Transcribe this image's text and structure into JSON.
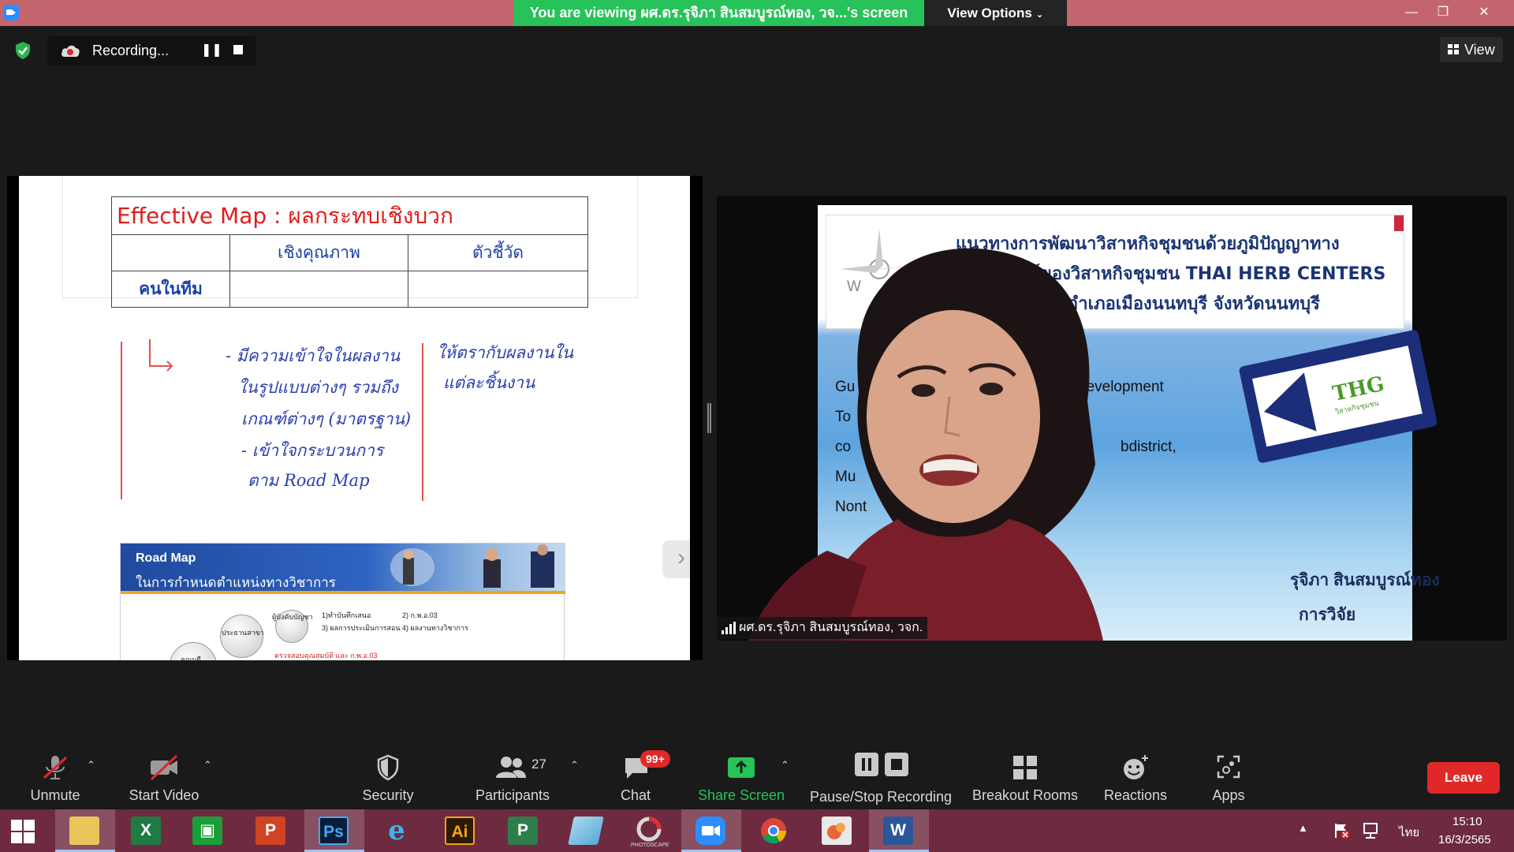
{
  "titlebar": {
    "banner": "You are viewing ผศ.ดร.รุจิภา สินสมบูรณ์ทอง, วจ...'s screen",
    "view_options": "View Options",
    "minimize": "—",
    "maximize": "❐",
    "close": "✕"
  },
  "recording": {
    "label": "Recording...",
    "pause": "❚❚"
  },
  "view_button": "View",
  "shared_screen": {
    "title": "Effective Map : ผลกระทบเชิงบวก",
    "col1": "เชิงคุณภาพ",
    "col2": "ตัวชี้วัด",
    "row1": "คนในทีม",
    "handwriting_left": [
      "- มีความเข้าใจในผลงาน",
      "ในรูปแบบต่างๆ รวมถึง",
      "เกณฑ์ต่างๆ (มาตรฐาน)",
      "- เข้าใจกระบวนการ",
      "ตาม Road Map"
    ],
    "handwriting_right": [
      "ให้ตรากับผลงานใน",
      "แต่ละชิ้นงาน"
    ],
    "roadmap_title": "Road Map",
    "roadmap_subtitle": "ในการกำหนดตำแหน่งทางวิชาการ",
    "roadmap_notes": [
      "1)ทำบันทึกเสนอ",
      "2) ก.พ.อ.03",
      "3) ผลการประเมินการสอน",
      "4) ผลงานทางวิชาการ",
      "ผู้บังคับบัญชา",
      "ประธานสาขา",
      "คณบดี",
      "ตรวจสอบคุณสมบัติ และ ก.พ.อ.03"
    ],
    "next": "›"
  },
  "video": {
    "slide_lines": [
      "แนวทางการพัฒนาวิสาหกิจชุมชนด้วยภูมิปัญญาทาง",
      "ย์ของวิสาหกิจชุมชน THAI HERB CENTERS",
      "อำเภอเมืองนนทบุรี จังหวัดนนทบุรี"
    ],
    "slide_left": [
      "Gu",
      "To",
      "co",
      "Mu",
      "Nont"
    ],
    "slide_right": [
      "development",
      "bdistrict,"
    ],
    "sign_logo": "THG",
    "sign_logo_sub": "วิสาหกิจชุมชน",
    "compass_w": "W",
    "presenter_slide_name": "รุจิภา สินสมบูรณ์ทอง",
    "presenter_slide_role": "การวิจัย",
    "name_tag": "ผศ.ดร.รุจิภา สินสมบูรณ์ทอง, วจก."
  },
  "toolbar": {
    "unmute": "Unmute",
    "start_video": "Start Video",
    "security": "Security",
    "participants": "Participants",
    "participants_count": "27",
    "chat": "Chat",
    "chat_badge": "99+",
    "share_screen": "Share Screen",
    "pause_stop_recording": "Pause/Stop Recording",
    "breakout_rooms": "Breakout Rooms",
    "reactions": "Reactions",
    "apps": "Apps",
    "leave": "Leave"
  },
  "taskbar": {
    "apps": [
      "File Explorer",
      "Excel",
      "Store",
      "PowerPoint",
      "Photoshop",
      "Internet Explorer",
      "Illustrator",
      "Project",
      "Notepad",
      "PhotoScape",
      "Zoom",
      "Chrome",
      "Office",
      "Word"
    ],
    "app_letters": {
      "excel": "X",
      "powerpoint": "P",
      "photoshop": "Ps",
      "illustrator": "Ai",
      "project": "P",
      "word": "W"
    },
    "photoscape_label": "PHOTOSCAPE",
    "language": "ไทย",
    "time": "15:10",
    "date": "16/3/2565"
  },
  "colors": {
    "titlebar": "#c4656d",
    "banner": "#27c25a",
    "leave": "#e02828",
    "taskbar": "#6e2b3f"
  }
}
